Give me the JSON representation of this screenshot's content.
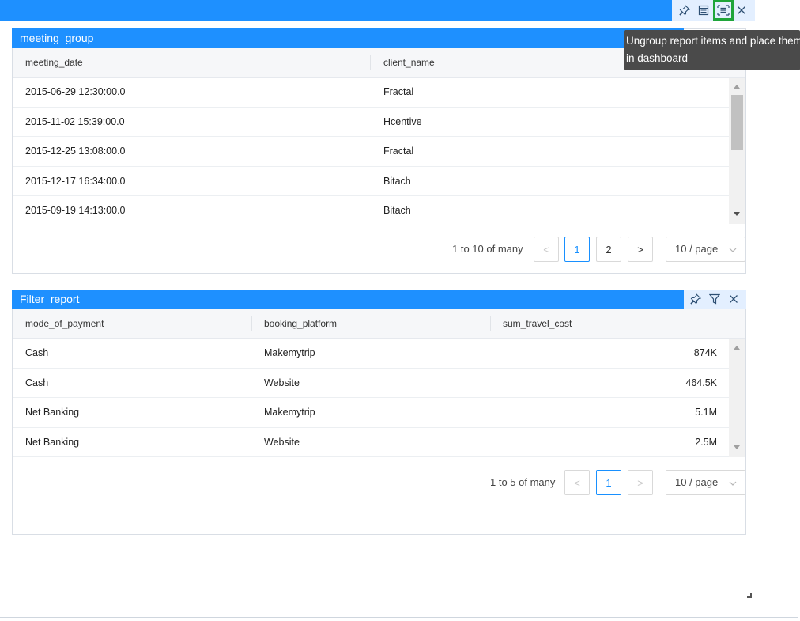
{
  "group": {
    "tools": [
      "pin-icon",
      "layout-icon",
      "ungroup-icon",
      "close-icon"
    ]
  },
  "tooltip": {
    "line1": "Ungroup report items and place them",
    "line2": "in dashboard"
  },
  "meeting_group": {
    "title": "meeting_group",
    "columns": [
      "meeting_date",
      "client_name"
    ],
    "rows": [
      [
        "2015-06-29 12:30:00.0",
        "Fractal"
      ],
      [
        "2015-11-02 15:39:00.0",
        "Hcentive"
      ],
      [
        "2015-12-25 13:08:00.0",
        "Fractal"
      ],
      [
        "2015-12-17 16:34:00.0",
        "Bitach"
      ],
      [
        "2015-09-19 14:13:00.0",
        "Bitach"
      ]
    ],
    "pager": {
      "summary": "1 to 10 of many",
      "prev": "<",
      "pages": [
        "1",
        "2"
      ],
      "next": ">",
      "page_size": "10 / page",
      "current_page": "1"
    }
  },
  "filter_report": {
    "title": "Filter_report",
    "tools": [
      "pin-icon",
      "filter-icon",
      "close-icon"
    ],
    "columns": [
      "mode_of_payment",
      "booking_platform",
      "sum_travel_cost"
    ],
    "rows": [
      [
        "Cash",
        "Makemytrip",
        "874K"
      ],
      [
        "Cash",
        "Website",
        "464.5K"
      ],
      [
        "Net Banking",
        "Makemytrip",
        "5.1M"
      ],
      [
        "Net Banking",
        "Website",
        "2.5M"
      ]
    ],
    "pager": {
      "summary": "1 to 5 of many",
      "prev": "<",
      "pages": [
        "1"
      ],
      "next": ">",
      "page_size": "10 / page",
      "current_page": "1"
    }
  },
  "colors": {
    "title_bar": "#1e90ff",
    "tool_bg": "#e3efff",
    "highlight": "#1fa53b",
    "tooltip_bg": "#4a4a4a",
    "active_page": "#1890ff"
  }
}
